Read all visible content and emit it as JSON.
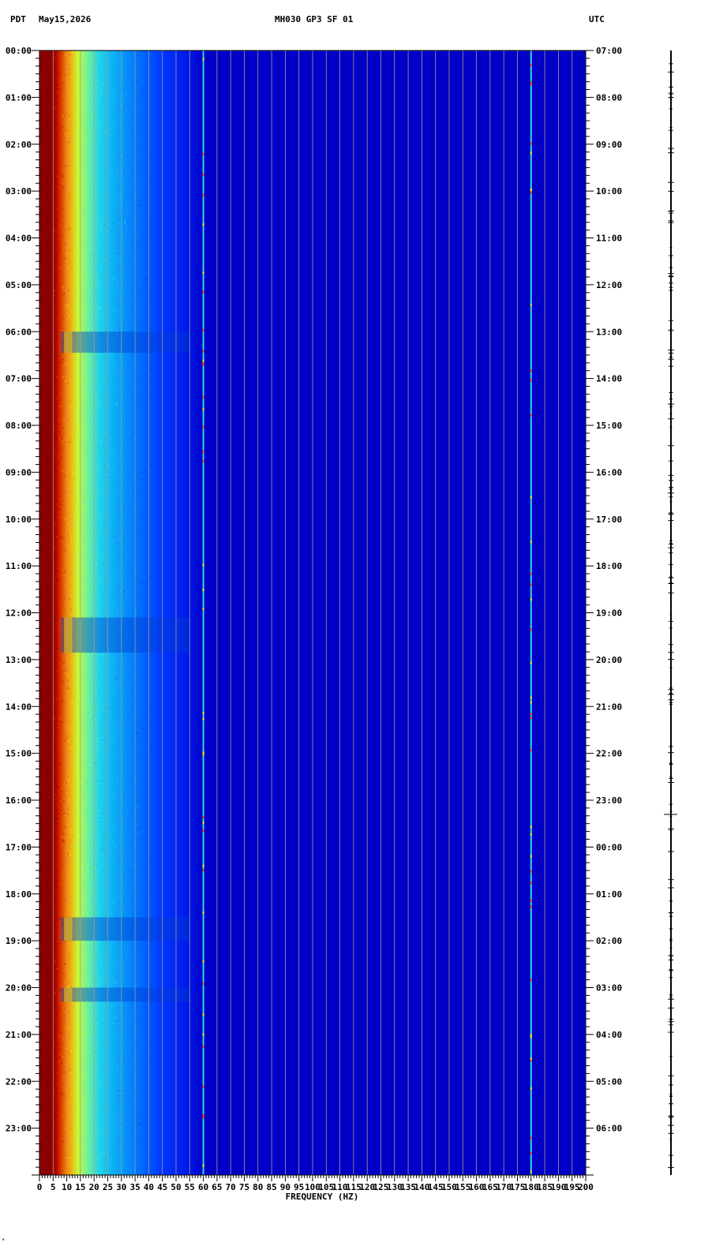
{
  "header": {
    "left_tz": "PDT",
    "date": "May15,2026",
    "station": "MH030 GP3 SF 01",
    "right_tz": "UTC"
  },
  "footer": {
    "mark": "*"
  },
  "colors": {
    "background": "#0000c8",
    "gridline": "#a0a08a",
    "low_band": "#8b0000",
    "axis": "#000000"
  },
  "chart_data": {
    "type": "heatmap",
    "title": "MH030 GP3 SF 01",
    "xlabel": "FREQUENCY (HZ)",
    "ylabel": "",
    "xlim": [
      0,
      200
    ],
    "x_ticks": [
      0,
      5,
      10,
      15,
      20,
      25,
      30,
      35,
      40,
      45,
      50,
      55,
      60,
      65,
      70,
      75,
      80,
      85,
      90,
      95,
      100,
      105,
      110,
      115,
      120,
      125,
      130,
      135,
      140,
      145,
      150,
      155,
      160,
      165,
      170,
      175,
      180,
      185,
      190,
      195,
      200
    ],
    "y_ticks_left": [
      "00:00",
      "01:00",
      "02:00",
      "03:00",
      "04:00",
      "05:00",
      "06:00",
      "07:00",
      "08:00",
      "09:00",
      "10:00",
      "11:00",
      "12:00",
      "13:00",
      "14:00",
      "15:00",
      "16:00",
      "17:00",
      "18:00",
      "19:00",
      "20:00",
      "21:00",
      "22:00",
      "23:00"
    ],
    "y_ticks_right": [
      "07:00",
      "08:00",
      "09:00",
      "10:00",
      "11:00",
      "12:00",
      "13:00",
      "14:00",
      "15:00",
      "16:00",
      "17:00",
      "18:00",
      "19:00",
      "20:00",
      "21:00",
      "22:00",
      "23:00",
      "00:00",
      "01:00",
      "02:00",
      "03:00",
      "04:00",
      "05:00",
      "06:00"
    ],
    "hours": 24,
    "grid": true,
    "grid_step_hz": 5,
    "lines_hz": [
      60,
      180
    ],
    "energy_hz": [
      0,
      6,
      10,
      14,
      18,
      22,
      28,
      35,
      45,
      55,
      60
    ],
    "energy_level": [
      1.0,
      0.97,
      0.82,
      0.66,
      0.55,
      0.46,
      0.38,
      0.3,
      0.2,
      0.1,
      0.0
    ],
    "events_hour": [
      6.0,
      12.1,
      18.5,
      20.0
    ],
    "events_duration_hr": [
      0.45,
      0.75,
      0.5,
      0.3
    ]
  }
}
